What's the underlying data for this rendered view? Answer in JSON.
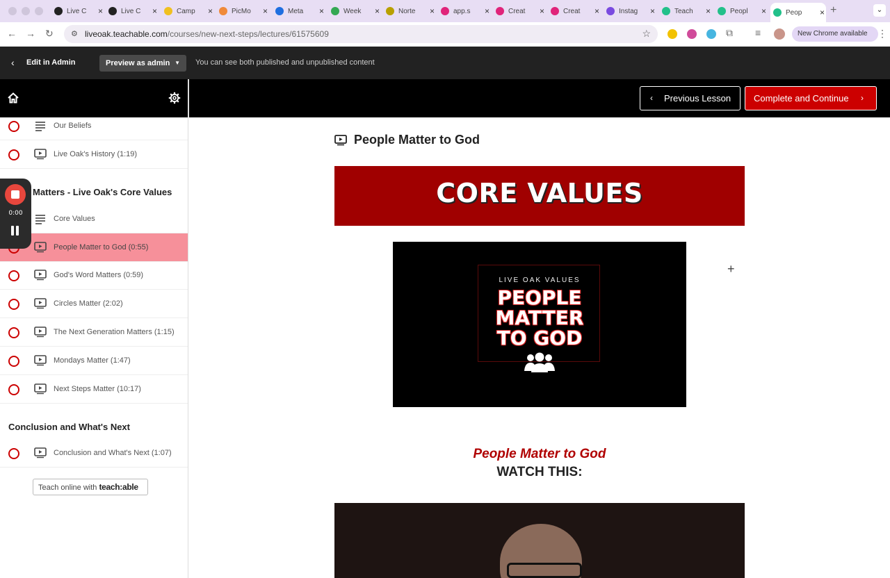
{
  "browser": {
    "tabs": [
      {
        "title": "Live C",
        "color": "#222"
      },
      {
        "title": "Live C",
        "color": "#222"
      },
      {
        "title": "Camp",
        "color": "#f0c020"
      },
      {
        "title": "PicMo",
        "color": "#f08a3a"
      },
      {
        "title": "Meta",
        "color": "#1f6fe0"
      },
      {
        "title": "Week",
        "color": "#34a853"
      },
      {
        "title": "Norte",
        "color": "#b8a000"
      },
      {
        "title": "app.s",
        "color": "#e0247a"
      },
      {
        "title": "Creat",
        "color": "#e0247a"
      },
      {
        "title": "Creat",
        "color": "#e0247a"
      },
      {
        "title": "Instag",
        "color": "#7a4ae0"
      },
      {
        "title": "Teach",
        "color": "#22c08a"
      },
      {
        "title": "Peopl",
        "color": "#22c08a"
      },
      {
        "title": "Peop",
        "color": "#22c08a"
      }
    ],
    "url_host": "liveoak.teachable.com",
    "url_path": "/courses/new-next-steps/lectures/61575609",
    "update_label": "New Chrome available"
  },
  "admin_bar": {
    "edit_label": "Edit in Admin",
    "preview_label": "Preview as admin",
    "note": "You can see both published and unpublished content"
  },
  "course_nav": {
    "previous_label": "Previous Lesson",
    "next_label": "Complete and Continue"
  },
  "sidebar": {
    "lessons_top": [
      {
        "title": "Our Beliefs",
        "type": "text"
      },
      {
        "title": "Live Oak's History (1:19)",
        "type": "video"
      }
    ],
    "section_core": "Matters - Live Oak's Core Values",
    "lessons_core": [
      {
        "title": "Core Values",
        "type": "text"
      },
      {
        "title": "People Matter to God (0:55)",
        "type": "video",
        "active": true
      },
      {
        "title": "God's Word Matters (0:59)",
        "type": "video"
      },
      {
        "title": "Circles Matter (2:02)",
        "type": "video"
      },
      {
        "title": "The Next Generation Matters (1:15)",
        "type": "video"
      },
      {
        "title": "Mondays Matter (1:47)",
        "type": "video"
      },
      {
        "title": "Next Steps Matter (10:17)",
        "type": "video"
      }
    ],
    "section_conclusion": "Conclusion and What's Next",
    "lessons_conclusion": [
      {
        "title": "Conclusion and What's Next (1:07)",
        "type": "video"
      }
    ],
    "badge_prefix": "Teach online with",
    "badge_brand": "teach:able"
  },
  "recorder": {
    "time": "0:00"
  },
  "lecture": {
    "title": "People Matter to God",
    "banner_text": "CORE VALUES",
    "card_sub": "LIVE OAK VALUES",
    "card_lines": [
      "PEOPLE",
      "MATTER",
      "TO GOD"
    ],
    "subheading": "People Matter to God",
    "watch_label": "WATCH THIS:"
  },
  "colors": {
    "accent": "#cc0000",
    "active_lesson": "#f6909a",
    "banner": "#a00000"
  }
}
